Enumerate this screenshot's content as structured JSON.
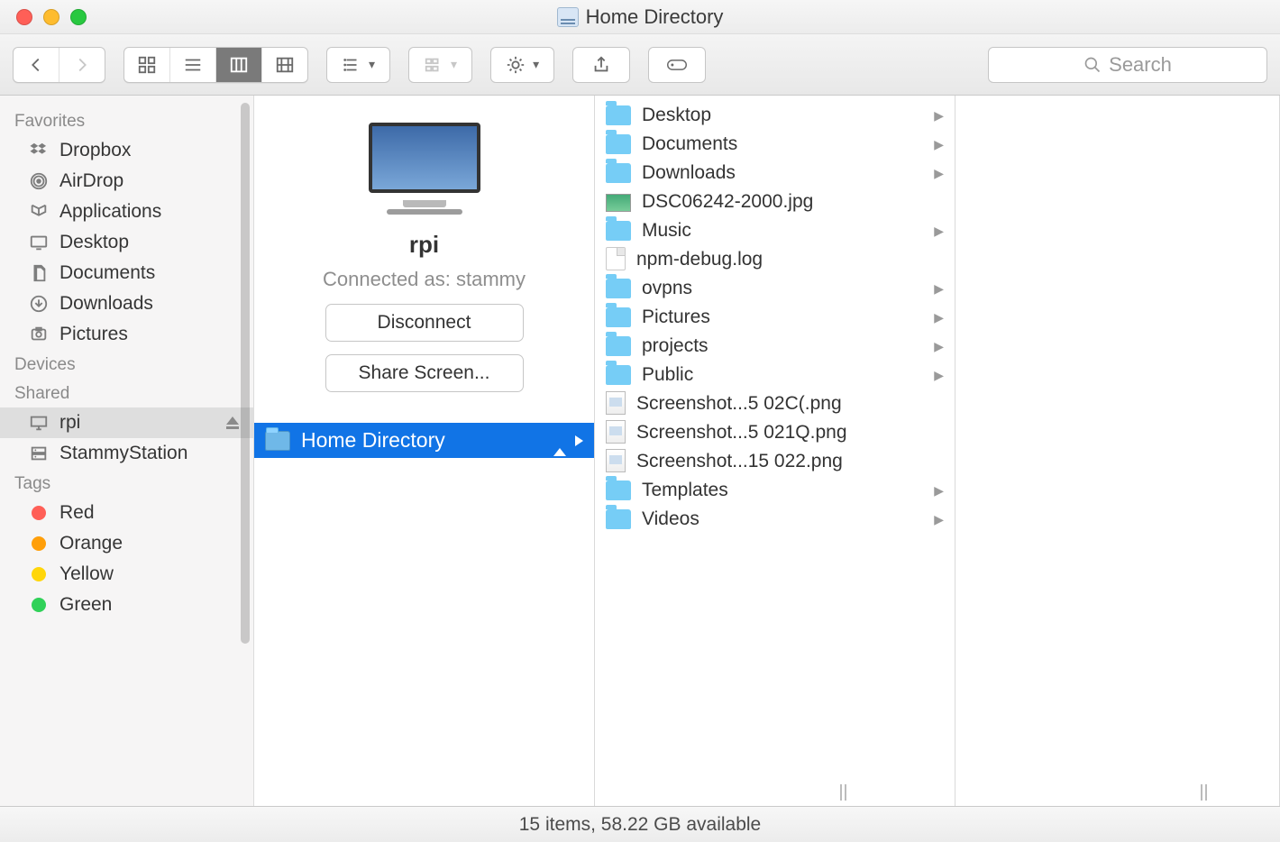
{
  "window": {
    "title": "Home Directory"
  },
  "search": {
    "placeholder": "Search"
  },
  "sidebar": {
    "sections": [
      {
        "label": "Favorites",
        "items": [
          {
            "label": "Dropbox",
            "icon": "dropbox-icon"
          },
          {
            "label": "AirDrop",
            "icon": "airdrop-icon"
          },
          {
            "label": "Applications",
            "icon": "applications-icon"
          },
          {
            "label": "Desktop",
            "icon": "desktop-icon"
          },
          {
            "label": "Documents",
            "icon": "documents-icon"
          },
          {
            "label": "Downloads",
            "icon": "downloads-icon"
          },
          {
            "label": "Pictures",
            "icon": "pictures-icon"
          }
        ]
      },
      {
        "label": "Devices",
        "items": []
      },
      {
        "label": "Shared",
        "items": [
          {
            "label": "rpi",
            "icon": "monitor-icon",
            "ejectable": true,
            "selected": true
          },
          {
            "label": "StammyStation",
            "icon": "server-icon"
          }
        ]
      },
      {
        "label": "Tags",
        "items": [
          {
            "label": "Red",
            "color": "#ff5f57"
          },
          {
            "label": "Orange",
            "color": "#ff9f0a"
          },
          {
            "label": "Yellow",
            "color": "#ffd60a"
          },
          {
            "label": "Green",
            "color": "#30d158"
          }
        ]
      }
    ]
  },
  "server": {
    "name": "rpi",
    "connected_prefix": "Connected as: ",
    "connected_user": "stammy",
    "disconnect_label": "Disconnect",
    "share_screen_label": "Share Screen...",
    "shares": [
      {
        "label": "Home Directory",
        "selected": true
      }
    ]
  },
  "column2": {
    "items": [
      {
        "label": "Desktop",
        "type": "folder",
        "has_children": true
      },
      {
        "label": "Documents",
        "type": "folder",
        "has_children": true
      },
      {
        "label": "Downloads",
        "type": "folder",
        "has_children": true
      },
      {
        "label": "DSC06242-2000.jpg",
        "type": "image",
        "has_children": false
      },
      {
        "label": "Music",
        "type": "folder",
        "has_children": true
      },
      {
        "label": "npm-debug.log",
        "type": "file",
        "has_children": false
      },
      {
        "label": "ovpns",
        "type": "folder",
        "has_children": true
      },
      {
        "label": "Pictures",
        "type": "folder",
        "has_children": true
      },
      {
        "label": "projects",
        "type": "folder",
        "has_children": true
      },
      {
        "label": "Public",
        "type": "folder",
        "has_children": true
      },
      {
        "label": "Screenshot...5 02C(.png",
        "type": "png",
        "has_children": false
      },
      {
        "label": "Screenshot...5 021Q.png",
        "type": "png",
        "has_children": false
      },
      {
        "label": "Screenshot...15 022.png",
        "type": "png",
        "has_children": false
      },
      {
        "label": "Templates",
        "type": "folder",
        "has_children": true
      },
      {
        "label": "Videos",
        "type": "folder",
        "has_children": true
      }
    ]
  },
  "status": {
    "text": "15 items, 58.22 GB available"
  }
}
